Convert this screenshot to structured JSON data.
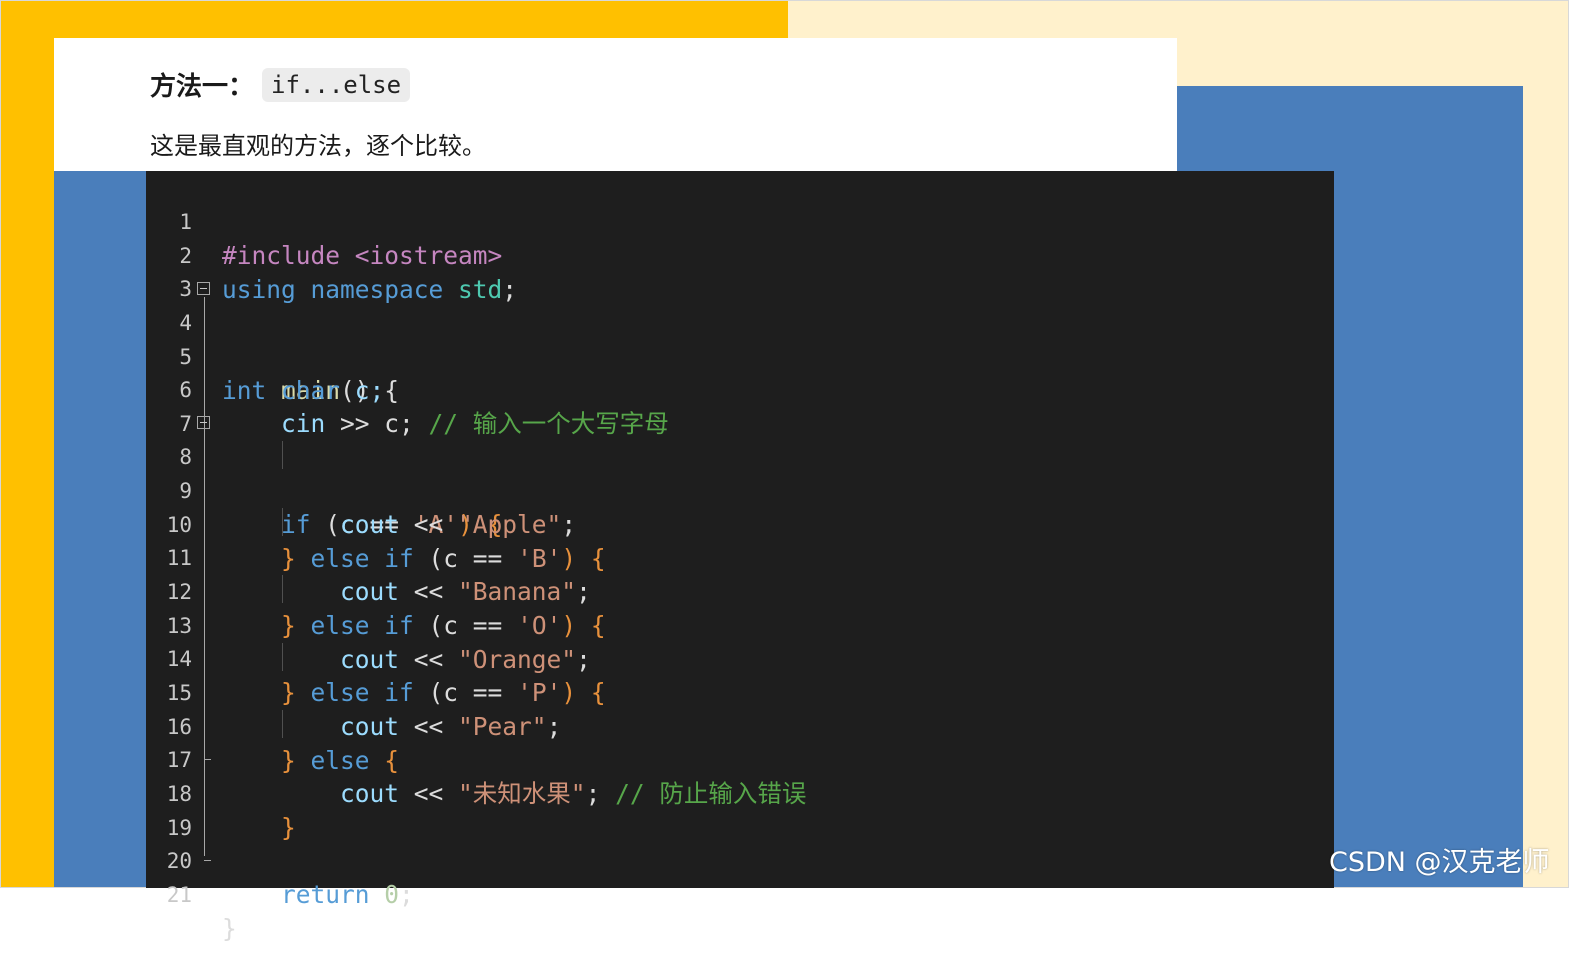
{
  "heading": {
    "title": "方法一：",
    "code": "if...else"
  },
  "description": "这是最直观的方法，逐个比较。",
  "colors": {
    "yellow_panel": "#ffc000",
    "cream_panel": "#fff1cc",
    "blue_panel": "#4a7ebb",
    "code_background": "#1e1e1e"
  },
  "code": {
    "line_numbers": [
      "1",
      "2",
      "3",
      "4",
      "5",
      "6",
      "7",
      "8",
      "9",
      "10",
      "11",
      "12",
      "13",
      "14",
      "15",
      "16",
      "17",
      "18",
      "19",
      "20",
      "21"
    ],
    "lines": [
      {
        "t1": "#include <iostream>"
      },
      {
        "t1": "using namespace ",
        "t2": "std",
        "t3": ";"
      },
      {},
      {
        "t1": "int ",
        "t2": "main",
        "t3": "() {"
      },
      {
        "t1": "char ",
        "t2": "c;"
      },
      {
        "t1": "cin",
        "t2": " >> c; ",
        "t3": "// 输入一个大写字母"
      },
      {},
      {
        "t1": "if ",
        "t2": "(c == ",
        "t3": "'A'",
        "t4": ") {"
      },
      {
        "t1": "cout",
        "t2": " << ",
        "t3": "\"Apple\"",
        "t4": ";"
      },
      {
        "t1": "} ",
        "t2": "else if ",
        "t3": "(c == ",
        "t4": "'B'",
        "t5": ") {"
      },
      {
        "t1": "cout",
        "t2": " << ",
        "t3": "\"Banana\"",
        "t4": ";"
      },
      {
        "t1": "} ",
        "t2": "else if ",
        "t3": "(c == ",
        "t4": "'O'",
        "t5": ") {"
      },
      {
        "t1": "cout",
        "t2": " << ",
        "t3": "\"Orange\"",
        "t4": ";"
      },
      {
        "t1": "} ",
        "t2": "else if ",
        "t3": "(c == ",
        "t4": "'P'",
        "t5": ") {"
      },
      {
        "t1": "cout",
        "t2": " << ",
        "t3": "\"Pear\"",
        "t4": ";"
      },
      {
        "t1": "} ",
        "t2": "else ",
        "t3": "{"
      },
      {
        "t1": "cout",
        "t2": " << ",
        "t3": "\"未知水果\"",
        "t4": "; ",
        "t5": "// 防止输入错误"
      },
      {
        "t1": "}"
      },
      {},
      {
        "t1": "return ",
        "t2": "0",
        "t3": ";"
      },
      {
        "t1": "}"
      }
    ]
  },
  "watermark": "CSDN @汉克老师"
}
